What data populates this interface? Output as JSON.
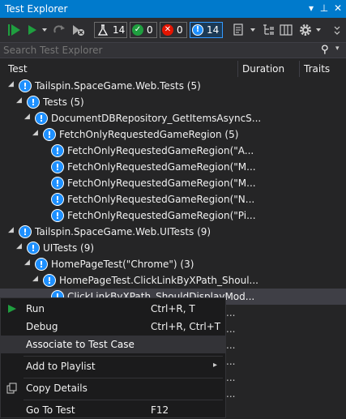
{
  "window": {
    "title": "Test Explorer",
    "dropdown_glyph": "▾",
    "pin_glyph": "⊥",
    "close_glyph": "✕"
  },
  "toolbar": {
    "run_all_icon": "run-all-icon",
    "run_icon": "run-icon",
    "counts": {
      "total": "14",
      "passed": "0",
      "failed": "0",
      "not_run": "14"
    },
    "colors": {
      "passed": "#1f9e3f",
      "failed": "#e51400",
      "not_run": "#1e90ff"
    }
  },
  "search": {
    "placeholder": "Search Test Explorer",
    "search_glyph": "⚲",
    "dropdown_glyph": "▾"
  },
  "columns": {
    "test": "Test",
    "duration": "Duration",
    "traits": "Traits"
  },
  "tree": [
    {
      "label": "Tailspin.SpaceGame.Web.Tests  (5)",
      "expanded": true
    },
    {
      "label": "Tests  (5)",
      "expanded": true
    },
    {
      "label": "DocumentDBRepository_GetItemsAsyncS...",
      "expanded": true
    },
    {
      "label": "FetchOnlyRequestedGameRegion  (5)",
      "expanded": true
    },
    {
      "label": "FetchOnlyRequestedGameRegion(\"A..."
    },
    {
      "label": "FetchOnlyRequestedGameRegion(\"M..."
    },
    {
      "label": "FetchOnlyRequestedGameRegion(\"M..."
    },
    {
      "label": "FetchOnlyRequestedGameRegion(\"N..."
    },
    {
      "label": "FetchOnlyRequestedGameRegion(\"Pi..."
    },
    {
      "label": "Tailspin.SpaceGame.Web.UITests  (9)",
      "expanded": true
    },
    {
      "label": "UITests  (9)",
      "expanded": true
    },
    {
      "label": "HomePageTest(\"Chrome\")  (3)",
      "expanded": true
    },
    {
      "label": "HomePageTest.ClickLinkByXPath_Shoul...",
      "expanded": true
    },
    {
      "label": "ClickLinkByXPath_ShouldDisplayMod..."
    }
  ],
  "context_menu": {
    "run": {
      "label": "Run",
      "shortcut": "Ctrl+R, T"
    },
    "debug": {
      "label": "Debug",
      "shortcut": "Ctrl+R, Ctrl+T"
    },
    "associate": {
      "label": "Associate to Test Case"
    },
    "add_to_playlist": {
      "label": "Add to Playlist",
      "submenu_glyph": "▸"
    },
    "copy_details": {
      "label": "Copy Details"
    },
    "go_to_test": {
      "label": "Go To Test",
      "shortcut": "F12"
    }
  },
  "trailing_dots": "..."
}
